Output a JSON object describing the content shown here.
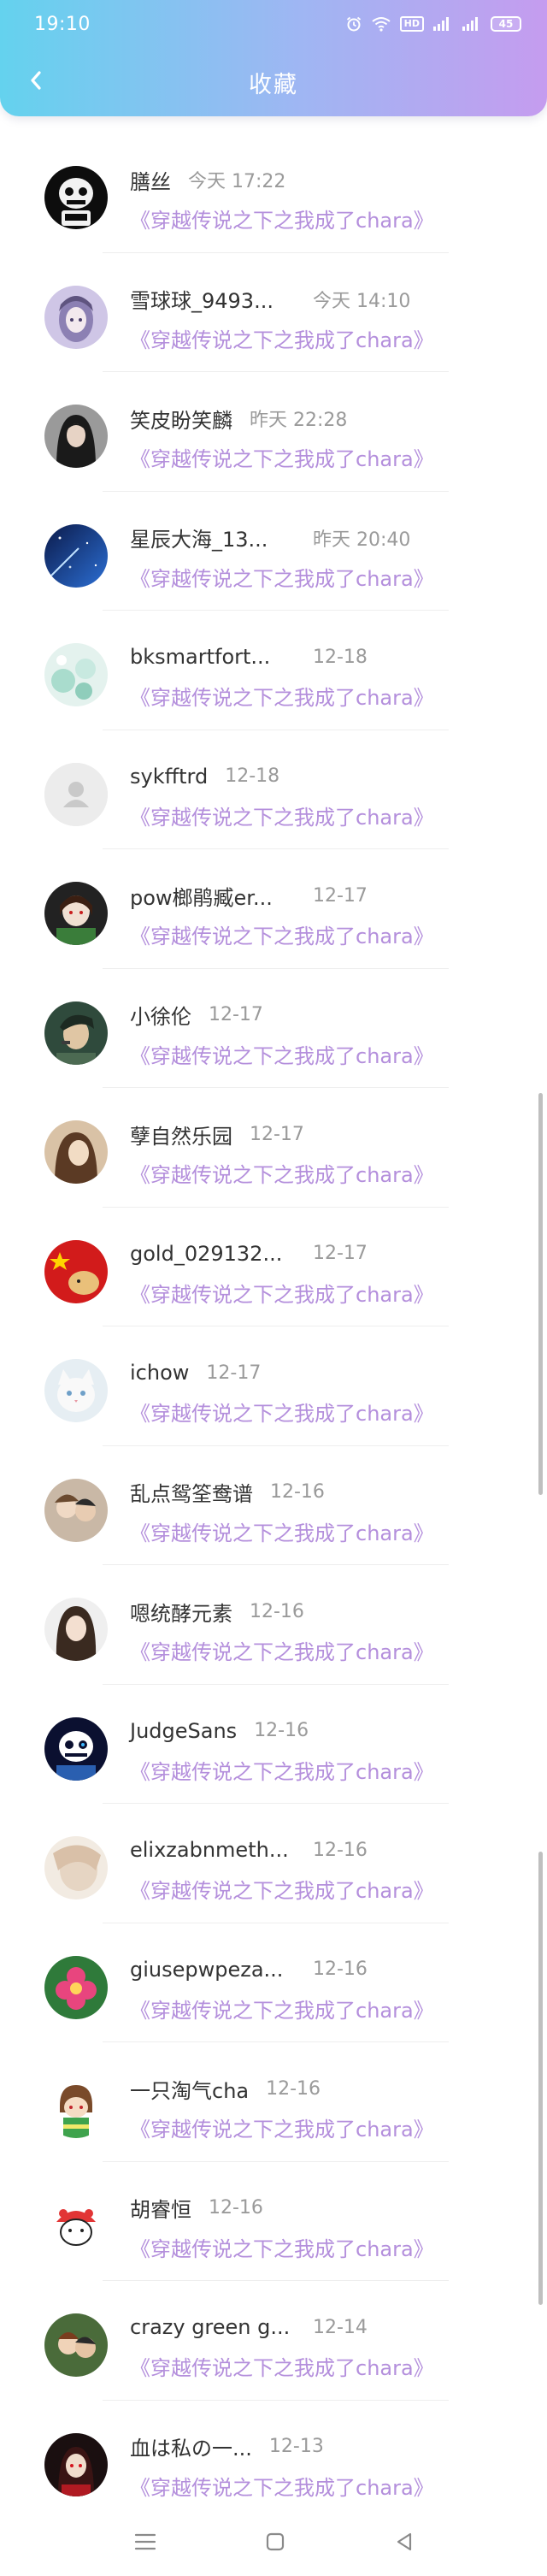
{
  "status_bar": {
    "time": "19:10",
    "icons": [
      "alarm-icon",
      "wifi-icon",
      "hd-icon",
      "signal-icon",
      "signal-icon"
    ],
    "hd_label": "HD",
    "battery": "45"
  },
  "header": {
    "title": "收藏",
    "back_icon": "chevron-left-icon"
  },
  "colors": {
    "header_gradient_start": "#64d2ee",
    "header_gradient_end": "#c59cef",
    "book_title": "#b48fdc",
    "username": "#333333",
    "timestamp": "#9a9a9a"
  },
  "favorites": [
    {
      "username": "膳丝",
      "time": "今天 17:22",
      "book": "《穿越传说之下之我成了chara》",
      "avatar": "skeleton-avatar"
    },
    {
      "username": "雪球球_9493...",
      "time": "今天 14:10",
      "book": "《穿越传说之下之我成了chara》",
      "avatar": "anime-girl-avatar"
    },
    {
      "username": "笑皮盼笑麟",
      "time": "昨天 22:28",
      "book": "《穿越传说之下之我成了chara》",
      "avatar": "dark-girl-avatar"
    },
    {
      "username": "星辰大海_13...",
      "time": "昨天 20:40",
      "book": "《穿越传说之下之我成了chara》",
      "avatar": "starry-sky-avatar"
    },
    {
      "username": "bksmartfort...",
      "time": "12-18",
      "book": "《穿越传说之下之我成了chara》",
      "avatar": "teal-bokeh-avatar"
    },
    {
      "username": "sykfftrd",
      "time": "12-18",
      "book": "《穿越传说之下之我成了chara》",
      "avatar": "default-user-avatar"
    },
    {
      "username": "pow榔鹃臧er...",
      "time": "12-17",
      "book": "《穿越传说之下之我成了chara》",
      "avatar": "dark-character-avatar"
    },
    {
      "username": "小徐伦",
      "time": "12-17",
      "book": "《穿越传说之下之我成了chara》",
      "avatar": "jojo-avatar"
    },
    {
      "username": "孽自然乐园",
      "time": "12-17",
      "book": "《穿越传说之下之我成了chara》",
      "avatar": "sepia-girl-avatar"
    },
    {
      "username": "gold_029132...",
      "time": "12-17",
      "book": "《穿越传说之下之我成了chara》",
      "avatar": "red-flag-avatar"
    },
    {
      "username": "ichow",
      "time": "12-17",
      "book": "《穿越传说之下之我成了chara》",
      "avatar": "white-cat-avatar"
    },
    {
      "username": "乱点鸳筌鸯谱",
      "time": "12-16",
      "book": "《穿越传说之下之我成了chara》",
      "avatar": "couple-avatar"
    },
    {
      "username": "嗯统酵元素",
      "time": "12-16",
      "book": "《穿越传说之下之我成了chara》",
      "avatar": "long-hair-girl-avatar"
    },
    {
      "username": "JudgeSans",
      "time": "12-16",
      "book": "《穿越传说之下之我成了chara》",
      "avatar": "sans-avatar"
    },
    {
      "username": "elixzabnmeth...",
      "time": "12-16",
      "book": "《穿越传说之下之我成了chara》",
      "avatar": "pastel-avatar"
    },
    {
      "username": "giusepwpeza...",
      "time": "12-16",
      "book": "《穿越传说之下之我成了chara》",
      "avatar": "pink-flower-avatar"
    },
    {
      "username": "一只淘气cha",
      "time": "12-16",
      "book": "《穿越传说之下之我成了chara》",
      "avatar": "chara-avatar"
    },
    {
      "username": "胡睿恒",
      "time": "12-16",
      "book": "《穿越传说之下之我成了chara》",
      "avatar": "red-hat-cartoon-avatar"
    },
    {
      "username": "crazy green g...",
      "time": "12-14",
      "book": "《穿越传说之下之我成了chara》",
      "avatar": "green-couple-avatar"
    },
    {
      "username": "血は私の一...",
      "time": "12-13",
      "book": "《穿越传说之下之我成了chara》",
      "avatar": "red-dark-avatar"
    }
  ],
  "nav_bar": {
    "buttons": [
      "menu-icon",
      "home-square-icon",
      "back-triangle-icon"
    ]
  }
}
